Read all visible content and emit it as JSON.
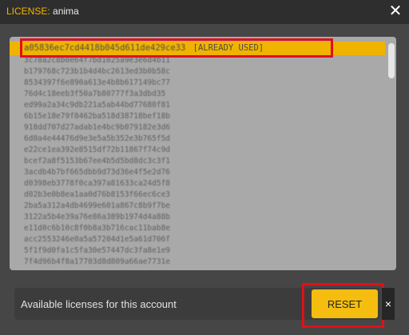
{
  "title": {
    "label": "LICENSE:",
    "value": "anima"
  },
  "icons": {
    "close": "close-icon",
    "reset_close": "close-icon"
  },
  "licenses": {
    "selected": {
      "key": "a05836ec7cd4418b045d611de429ce33",
      "status": "[ALREADY USED]"
    },
    "rows": [
      "3c78a2c8b0e64f7bd1025a9e3e6d4b11",
      "b179768c723b1b4d4bc2613ed3b0b58c",
      "8534397f6e890a613e4b8b617149bc77",
      "76d4c18eeb3f50a7b80777f3a3dbd35",
      "ed99a2a34c9db221a5ab44bd77680f81",
      "6b15e18e79f8462ba518d38718bef18b",
      "918dd707d27adab1e4bc9b079182e3d6",
      "6d0a4e44476d9e3e5a5b352e3b765f5d",
      "e22ce1ea392e8515df72b11867f74c9d",
      "bcef2a8f5153b67ee4b5d5bd8dc3c3f1",
      "3acdb4b7bf665dbb9d73d36e4f5e2d76",
      "d0398eb3778f0ca397a81633ca24d5f8",
      "d02b3e0b8ea1aa0d76b8153f66ec6ce3",
      "2ba5a312a4db4699e601a867c8b9f7be",
      "3122a5b4e39a76e86a389b1974d4a88b",
      "e11d0c6b10c8f0b8a3b716cac11bab8e",
      "acc2553246e0a5a57204d1e5a61d706f",
      "5f1f9d0fa1c5fa30e57447dc3fa8e1e9",
      "7f4d96b4f8a17703d8d809a66ae7731e"
    ]
  },
  "footer": {
    "available_text": "Available licenses for this account",
    "reset_label": "RESET",
    "close_glyph": "×"
  },
  "colors": {
    "accent": "#f0b400",
    "highlight": "#e0101a",
    "panel": "#a9a9a9",
    "background": "#464646"
  }
}
